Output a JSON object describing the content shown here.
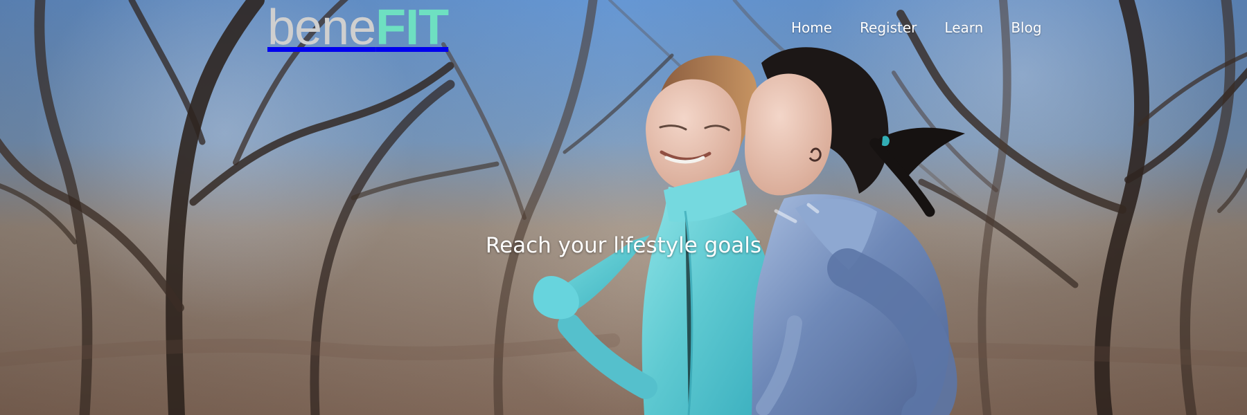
{
  "site": {
    "logo_light": "bene",
    "logo_strong": "FIT"
  },
  "navigation": [
    {
      "label": "Home"
    },
    {
      "label": "Register"
    },
    {
      "label": "Learn"
    },
    {
      "label": "Blog"
    }
  ],
  "hero": {
    "heading": "Reach your lifestyle goals"
  },
  "colors": {
    "logo_accent": "#6ee0c1",
    "logo_light": "#cfcfcf",
    "nav_text": "#ffffff",
    "teal_jacket": "#63c9d3",
    "blue_hoodie": "#6f89b8"
  }
}
